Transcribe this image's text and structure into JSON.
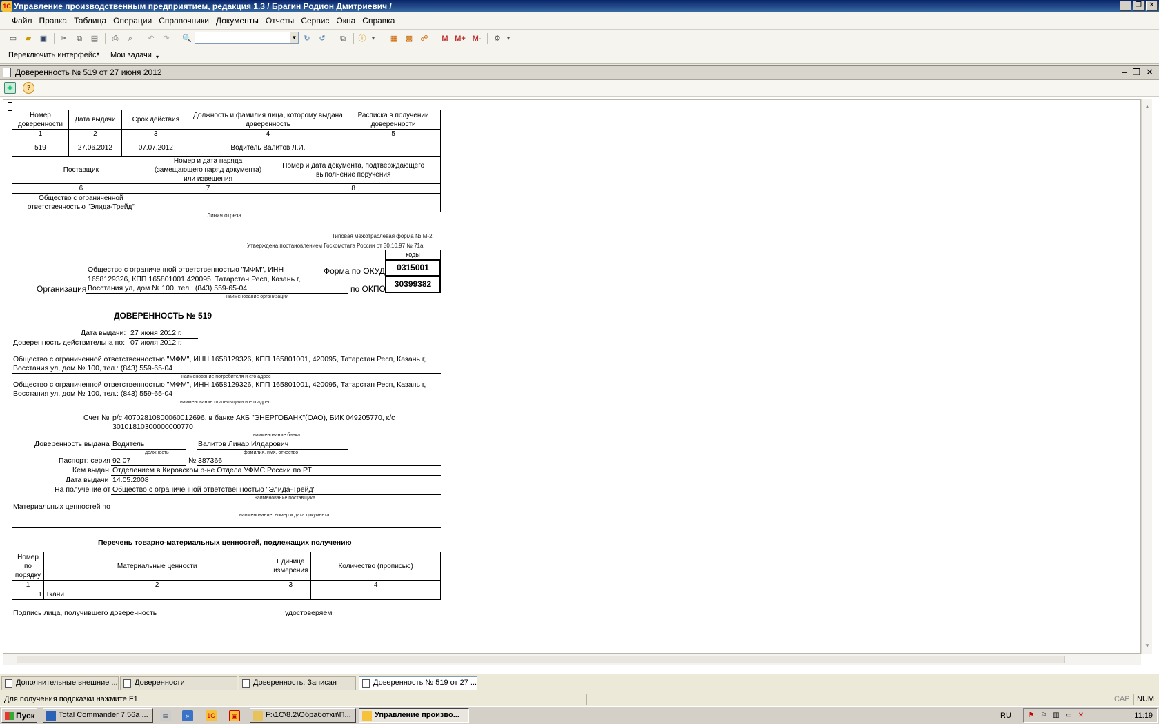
{
  "window": {
    "title": "Управление производственным предприятием, редакция 1.3 / Брагин Родион Дмитриевич /",
    "app_icon": "1С"
  },
  "menu": [
    "Файл",
    "Правка",
    "Таблица",
    "Операции",
    "Справочники",
    "Документы",
    "Отчеты",
    "Сервис",
    "Окна",
    "Справка"
  ],
  "toolbar": {
    "search_value": "",
    "m_label": "M",
    "m_plus_label": "M+",
    "m_minus_label": "M-"
  },
  "interface_bar": {
    "switch_label": "Переключить интерфейс",
    "tasks_label": "Мои задачи"
  },
  "document": {
    "title": "Доверенность № 519 от 27 июня 2012"
  },
  "stub": {
    "headers": [
      "Номер доверенности",
      "Дата выдачи",
      "Срок действия",
      "Должность и фамилия лица, которому выдана доверенность",
      "Расписка в получении доверенности"
    ],
    "nums1": [
      "1",
      "2",
      "3",
      "4",
      "5"
    ],
    "row": [
      "519",
      "27.06.2012",
      "07.07.2012",
      "Водитель Валитов Л.И.",
      ""
    ],
    "headers2": [
      "Поставщик",
      "Номер и дата наряда (замещающего наряд документа) или извещения",
      "Номер и дата документа, подтверждающего выполнение поручения"
    ],
    "nums2": [
      "6",
      "7",
      "8"
    ],
    "supplier": "Общество с ограниченной ответственностью \"Элида-Трейд\"",
    "cut_line": "Линия отреза"
  },
  "form": {
    "type_note": "Типовая межотраслевая форма № М-2",
    "approved_note": "Утверждена постановлением Госкомстата России от 30.10.97 № 71а",
    "codes_label": "коды",
    "okud_label": "Форма по ОКУД",
    "okud_value": "0315001",
    "okpo_label": "по ОКПО",
    "okpo_value": "30399382",
    "org_label": "Организация",
    "org_value_1": "Общество с ограниченной ответственностью \"МФМ\", ИНН",
    "org_value_2": "1658129326, КПП 165801001,420095, Татарстан Респ, Казань г,",
    "org_value_3": "Восстания ул, дом № 100, тел.: (843) 559-65-04",
    "org_caption": "наименование организации",
    "heading": "ДОВЕРЕННОСТЬ №",
    "number": "519",
    "issue_date_label": "Дата выдачи:",
    "issue_date": "27 июня 2012 г.",
    "valid_to_label": "Доверенность действительна по:",
    "valid_to": "07 июля 2012 г.",
    "consumer_1": "Общество с ограниченной ответственностью \"МФМ\", ИНН 1658129326, КПП 165801001, 420095, Татарстан Респ, Казань г,",
    "consumer_2": "Восстания ул, дом № 100, тел.: (843) 559-65-04",
    "consumer_caption": "наименование потребителя и его адрес",
    "payer_1": "Общество с ограниченной ответственностью \"МФМ\", ИНН 1658129326, КПП 165801001, 420095, Татарстан Респ, Казань г,",
    "payer_2": "Восстания ул, дом № 100, тел.: (843) 559-65-04",
    "payer_caption": "наименование плательщика и его адрес",
    "account_label": "Счет №",
    "account_1": "р/с 40702810800060012696, в банке АКБ \"ЭНЕРГОБАНК\"(ОАО), БИК 049205770, к/с",
    "account_2": "30101810300000000770",
    "bank_caption": "наименование банка",
    "issued_to_label": "Доверенность выдана",
    "position": "Водитель",
    "person": "Валитов Линар Илдарович",
    "position_caption": "должность",
    "person_caption": "фамилия, имя, отчество",
    "passport_label": "Паспорт: серия",
    "passport_series": "92 07",
    "passport_no_label": "№",
    "passport_no": "387366",
    "issued_by_label": "Кем выдан",
    "issued_by": "Отделением в Кировском р-не Отдела УФМС России по РТ",
    "passport_date_label": "Дата выдачи",
    "passport_date": "14.05.2008",
    "receive_from_label": "На получение от",
    "receive_from": "Общество с ограниченной ответственностью \"Элида-Трейд\"",
    "supplier_caption": "наименование поставщика",
    "materials_label": "Материальных ценностей по",
    "doc_caption": "наименование, номер и дата документа",
    "list_title": "Перечень товарно-материальных ценностей, подлежащих получению",
    "list_headers": [
      "Номер по порядку",
      "Материальные ценности",
      "Единица измерения",
      "Количество (прописью)"
    ],
    "list_nums": [
      "1",
      "2",
      "3",
      "4"
    ],
    "list_row": [
      "1",
      "Ткани",
      "",
      ""
    ],
    "signature_label": "Подпись лица, получившего доверенность",
    "certify_label": "удостоверяем"
  },
  "mdi_tabs": [
    "Дополнительные внешние ...",
    "Доверенности",
    "Доверенность: Записан",
    "Доверенность № 519 от 27 ..."
  ],
  "status": {
    "hint": "Для получения подсказки нажмите F1",
    "cap": "CAP",
    "num": "NUM"
  },
  "taskbar": {
    "start": "Пуск",
    "tasks": [
      "Total Commander 7.56a ...",
      "F:\\1С\\8.2\\Обработки\\П...",
      "Управление произво..."
    ],
    "lang": "RU",
    "clock": "11:19"
  }
}
